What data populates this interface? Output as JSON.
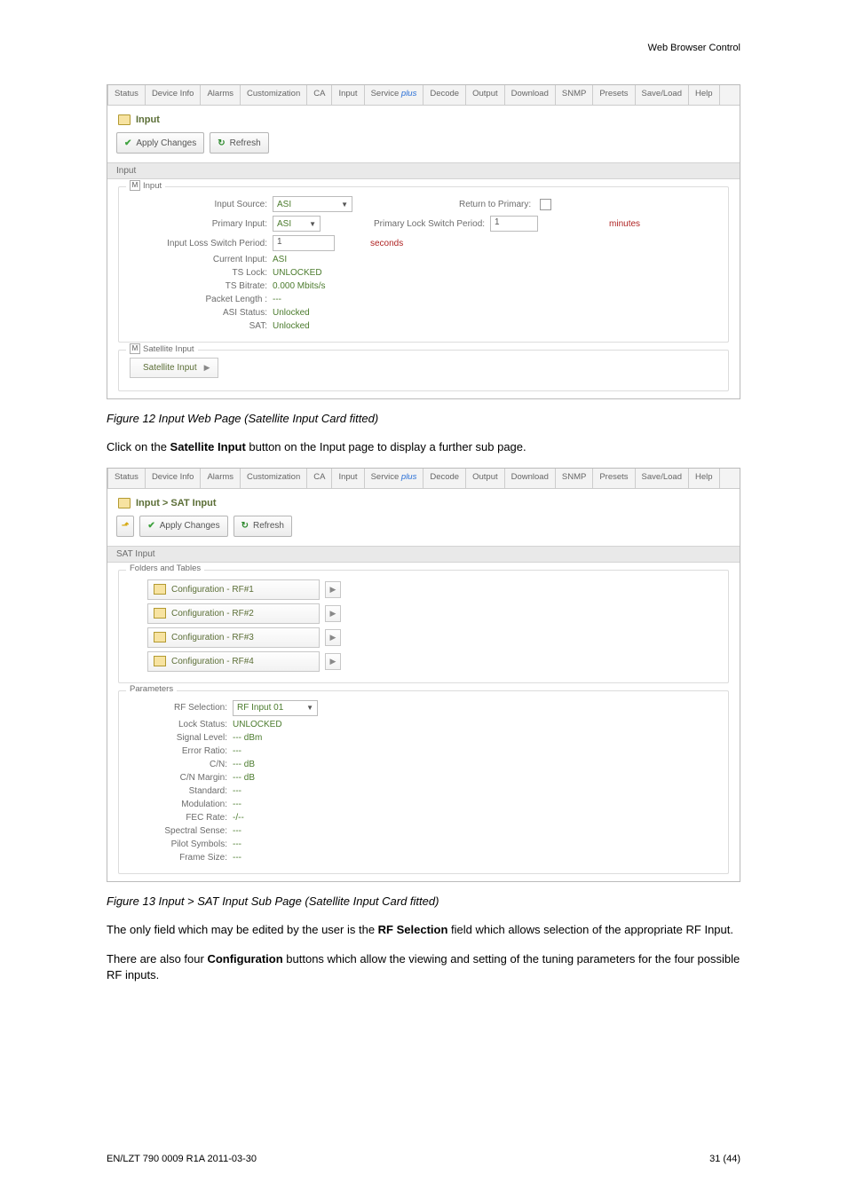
{
  "header": {
    "section": "Web Browser Control"
  },
  "tabs": [
    "Status",
    "Device Info",
    "Alarms",
    "Customization",
    "CA",
    "Input",
    "Service plus",
    "Decode",
    "Output",
    "Download",
    "SNMP",
    "Presets",
    "Save/Load",
    "Help"
  ],
  "shot1": {
    "crumb": "Input",
    "apply": "Apply Changes",
    "refresh": "Refresh",
    "section": "Input",
    "legend": "Input",
    "rows": {
      "input_source_lbl": "Input Source:",
      "input_source_val": "ASI",
      "return_primary_lbl": "Return to Primary:",
      "primary_input_lbl": "Primary Input:",
      "primary_input_val": "ASI",
      "primary_period_lbl": "Primary Lock Switch Period:",
      "primary_period_val": "1",
      "minutes": "minutes",
      "loss_period_lbl": "Input Loss Switch Period:",
      "loss_period_val": "1",
      "seconds": "seconds",
      "current_input_lbl": "Current Input:",
      "current_input_val": "ASI",
      "ts_lock_lbl": "TS Lock:",
      "ts_lock_val": "UNLOCKED",
      "ts_bitrate_lbl": "TS Bitrate:",
      "ts_bitrate_val": "0.000 Mbits/s",
      "pkt_len_lbl": "Packet Length :",
      "pkt_len_val": "---",
      "asi_status_lbl": "ASI Status:",
      "asi_status_val": "Unlocked",
      "sat_lbl": "SAT:",
      "sat_val": "Unlocked"
    },
    "sat_legend": "Satellite Input",
    "sat_btn": "Satellite Input"
  },
  "caption1": "Figure 12   Input Web Page (Satellite Input Card fitted)",
  "para1_a": "Click on the ",
  "para1_b": "Satellite Input",
  "para1_c": " button on the Input page to display a further sub page.",
  "shot2": {
    "crumb": "Input > SAT Input",
    "apply": "Apply Changes",
    "refresh": "Refresh",
    "section": "SAT Input",
    "ft_legend": "Folders and Tables",
    "cfg": [
      "Configuration - RF#1",
      "Configuration - RF#2",
      "Configuration - RF#3",
      "Configuration - RF#4"
    ],
    "params_legend": "Parameters",
    "params": {
      "rf_sel_lbl": "RF Selection:",
      "rf_sel_val": "RF Input 01",
      "lock_lbl": "Lock Status:",
      "lock_val": "UNLOCKED",
      "siglvl_lbl": "Signal Level:",
      "siglvl_val": "--- dBm",
      "err_lbl": "Error Ratio:",
      "err_val": "---",
      "cn_lbl": "C/N:",
      "cn_val": "--- dB",
      "cnm_lbl": "C/N Margin:",
      "cnm_val": "--- dB",
      "std_lbl": "Standard:",
      "std_val": "---",
      "mod_lbl": "Modulation:",
      "mod_val": "---",
      "fec_lbl": "FEC Rate:",
      "fec_val": "-/--",
      "ss_lbl": "Spectral Sense:",
      "ss_val": "---",
      "ps_lbl": "Pilot Symbols:",
      "ps_val": "---",
      "fs_lbl": "Frame Size:",
      "fs_val": "---"
    }
  },
  "caption2": "Figure 13   Input > SAT Input Sub Page (Satellite Input Card fitted)",
  "para2_a": "The only field which may be edited by the user is the ",
  "para2_b": "RF Selection",
  "para2_c": " field which allows selection of the appropriate RF Input.",
  "para3_a": "There are also four ",
  "para3_b": "Configuration",
  "para3_c": " buttons which allow the viewing and setting of the tuning parameters for the four possible RF inputs.",
  "footer": {
    "left": "EN/LZT 790 0009 R1A 2011-03-30",
    "right": "31 (44)"
  }
}
